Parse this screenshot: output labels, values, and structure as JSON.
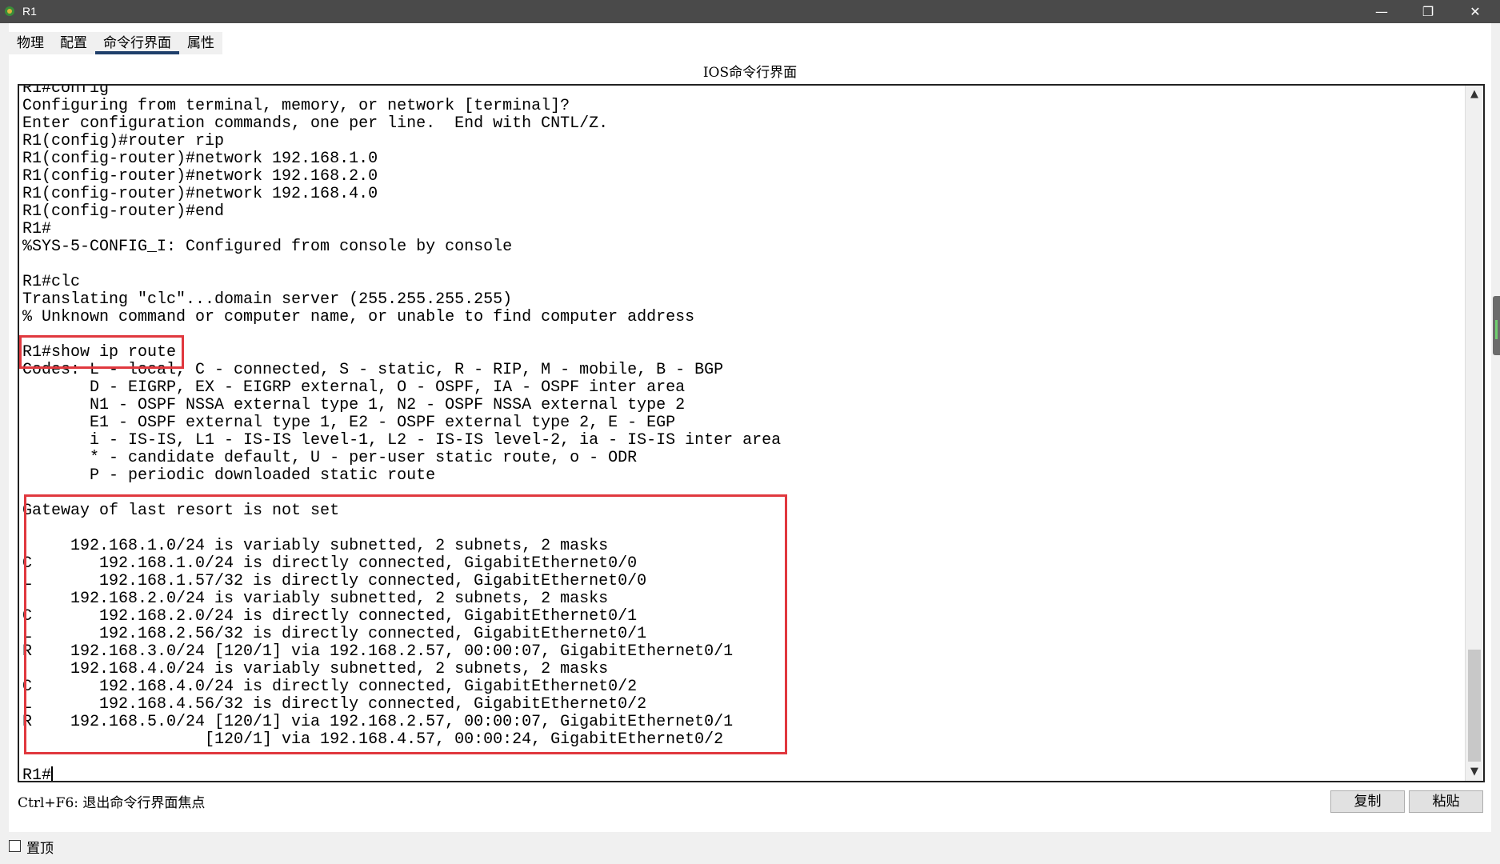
{
  "window": {
    "title": "R1",
    "minimize_glyph": "—",
    "maximize_glyph": "❐",
    "close_glyph": "✕"
  },
  "tabs": [
    {
      "label": "物理",
      "active": false
    },
    {
      "label": "配置",
      "active": false
    },
    {
      "label": "命令行界面",
      "active": true
    },
    {
      "label": "属性",
      "active": false
    }
  ],
  "section_title": "IOS命令行界面",
  "terminal": {
    "lines": [
      "R1#config",
      "Configuring from terminal, memory, or network [terminal]?",
      "Enter configuration commands, one per line.  End with CNTL/Z.",
      "R1(config)#router rip",
      "R1(config-router)#network 192.168.1.0",
      "R1(config-router)#network 192.168.2.0",
      "R1(config-router)#network 192.168.4.0",
      "R1(config-router)#end",
      "R1#",
      "%SYS-5-CONFIG_I: Configured from console by console",
      "",
      "R1#clc",
      "Translating \"clc\"...domain server (255.255.255.255)",
      "% Unknown command or computer name, or unable to find computer address",
      "",
      "R1#show ip route",
      "Codes: L - local, C - connected, S - static, R - RIP, M - mobile, B - BGP",
      "       D - EIGRP, EX - EIGRP external, O - OSPF, IA - OSPF inter area",
      "       N1 - OSPF NSSA external type 1, N2 - OSPF NSSA external type 2",
      "       E1 - OSPF external type 1, E2 - OSPF external type 2, E - EGP",
      "       i - IS-IS, L1 - IS-IS level-1, L2 - IS-IS level-2, ia - IS-IS inter area",
      "       * - candidate default, U - per-user static route, o - ODR",
      "       P - periodic downloaded static route",
      "",
      "Gateway of last resort is not set",
      "",
      "     192.168.1.0/24 is variably subnetted, 2 subnets, 2 masks",
      "C       192.168.1.0/24 is directly connected, GigabitEthernet0/0",
      "L       192.168.1.57/32 is directly connected, GigabitEthernet0/0",
      "     192.168.2.0/24 is variably subnetted, 2 subnets, 2 masks",
      "C       192.168.2.0/24 is directly connected, GigabitEthernet0/1",
      "L       192.168.2.56/32 is directly connected, GigabitEthernet0/1",
      "R    192.168.3.0/24 [120/1] via 192.168.2.57, 00:00:07, GigabitEthernet0/1",
      "     192.168.4.0/24 is variably subnetted, 2 subnets, 2 masks",
      "C       192.168.4.0/24 is directly connected, GigabitEthernet0/2",
      "L       192.168.4.56/32 is directly connected, GigabitEthernet0/2",
      "R    192.168.5.0/24 [120/1] via 192.168.2.57, 00:00:07, GigabitEthernet0/1",
      "                   [120/1] via 192.168.4.57, 00:00:24, GigabitEthernet0/2",
      ""
    ],
    "prompt": "R1#"
  },
  "footer": {
    "hint": "Ctrl+F6: 退出命令行界面焦点",
    "copy_label": "复制",
    "paste_label": "粘贴"
  },
  "pin": {
    "label": "置顶",
    "checked": false
  },
  "colors": {
    "highlight": "#e0383e",
    "titlebar": "#4a4a4a",
    "tab_underline": "#1f3f6b"
  }
}
